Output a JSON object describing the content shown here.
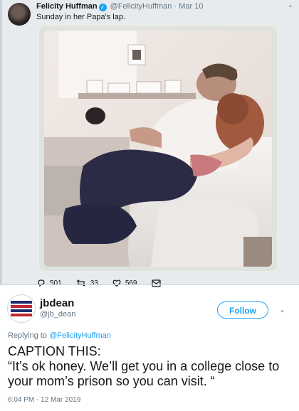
{
  "top_tweet": {
    "author_name": "Felicity Huffman",
    "handle": "@FelicityHuffman",
    "separator": "·",
    "date": "Mar 10",
    "text": "Sunday in her Papa's lap.",
    "reply_count": "501",
    "retweet_count": "33",
    "like_count": "569"
  },
  "bottom_tweet": {
    "author_name": "jbdean",
    "handle": "@jb_dean",
    "follow_label": "Follow",
    "replying_prefix": "Replying to",
    "replying_to": "@FelicityHuffman",
    "caption_line1": "CAPTION THIS:",
    "caption_line2": "“It’s ok honey. We’ll get you in a college close to your mom’s prison so you can visit. “",
    "timestamp": "6:04 PM - 12 Mar 2019",
    "avatar_text": "I'M ONE OF 65,844,954 AMERICANS AGAINST TRUMP"
  },
  "colors": {
    "accent": "#1da1f2",
    "secondary_text": "#657786",
    "top_background": "#e8ebee"
  },
  "icons": [
    "verified-icon",
    "chevron-down-icon",
    "reply-icon",
    "retweet-icon",
    "like-icon",
    "message-icon"
  ]
}
